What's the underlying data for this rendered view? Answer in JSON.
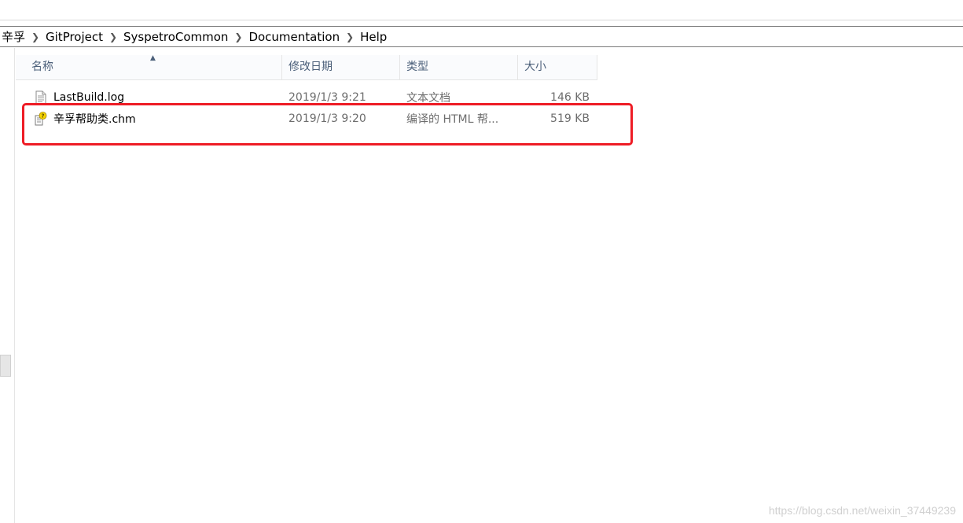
{
  "breadcrumb": [
    "辛孚",
    "GitProject",
    "SyspetroCommon",
    "Documentation",
    "Help"
  ],
  "columns": {
    "name": "名称",
    "date": "修改日期",
    "type": "类型",
    "size": "大小"
  },
  "files": [
    {
      "name": "LastBuild.log",
      "date": "2019/1/3 9:21",
      "type": "文本文档",
      "size": "146 KB",
      "icon": "text-document-icon"
    },
    {
      "name": "辛孚帮助类.chm",
      "date": "2019/1/3 9:20",
      "type": "编译的 HTML 帮...",
      "size": "519 KB",
      "icon": "chm-help-file-icon"
    }
  ],
  "annotation": {
    "highlight_color": "#ee1c25"
  },
  "watermark": "https://blog.csdn.net/weixin_37449239"
}
